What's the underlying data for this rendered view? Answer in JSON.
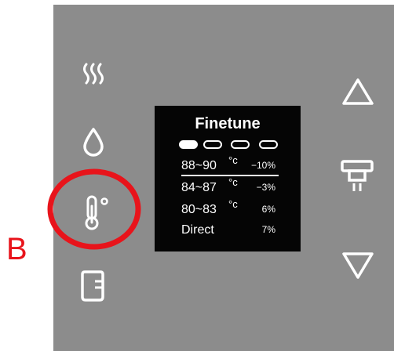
{
  "callout": {
    "letter": "B",
    "color": "#e8141b"
  },
  "display": {
    "title": "Finetune",
    "indicators": [
      {
        "state": "active"
      },
      {
        "state": "inactive"
      },
      {
        "state": "inactive"
      },
      {
        "state": "inactive"
      }
    ],
    "rows": [
      {
        "range": "88~90",
        "unit": "°c",
        "adjustment": "−10%"
      },
      {
        "range": "84~87",
        "unit": "°c",
        "adjustment": "−3%"
      },
      {
        "range": "80~83",
        "unit": "°c",
        "adjustment": "6%"
      },
      {
        "range": "Direct",
        "unit": "",
        "adjustment": "7%"
      }
    ]
  },
  "left_controls": [
    "steam-icon",
    "water-drop-icon",
    "thermometer-icon",
    "cup-icon"
  ],
  "right_controls": [
    "arrow-up-icon",
    "dispense-icon",
    "arrow-down-icon"
  ]
}
